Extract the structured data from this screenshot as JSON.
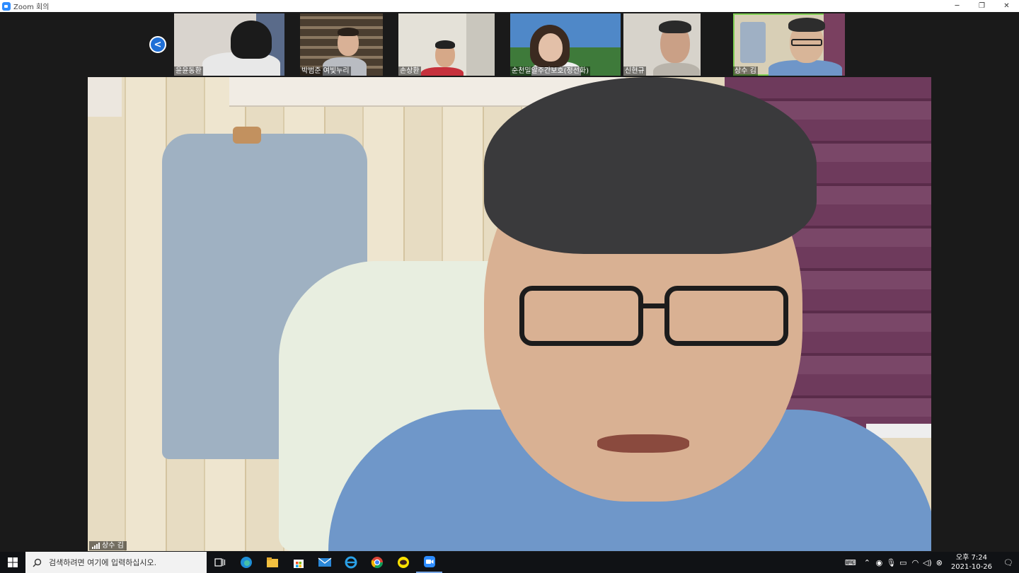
{
  "window": {
    "title": "Zoom 회의",
    "controls": [
      "─",
      "❐",
      "✕"
    ]
  },
  "gallery": {
    "prev_label": "<",
    "participants": [
      {
        "name": "윤윤동환"
      },
      {
        "name": "박범준 여빛누리"
      },
      {
        "name": "손상환"
      },
      {
        "name": "순천밀알주간보호(정선화)"
      },
      {
        "name": "신현규"
      },
      {
        "name": "상수 김",
        "active": true
      }
    ]
  },
  "speaker": {
    "name": "상수 김"
  },
  "taskbar": {
    "search_placeholder": "검색하려면 여기에 입력하십시오.",
    "apps": [
      "task-view",
      "edge",
      "file-explorer",
      "store",
      "mail",
      "internet-explorer",
      "chrome",
      "kakaotalk",
      "zoom"
    ],
    "clock": {
      "time": "오후 7:24",
      "date": "2021-10-26"
    }
  },
  "colors": {
    "accent": "#2d8cff",
    "active_border": "#7fcf52",
    "taskbar_bg": "#101215"
  }
}
